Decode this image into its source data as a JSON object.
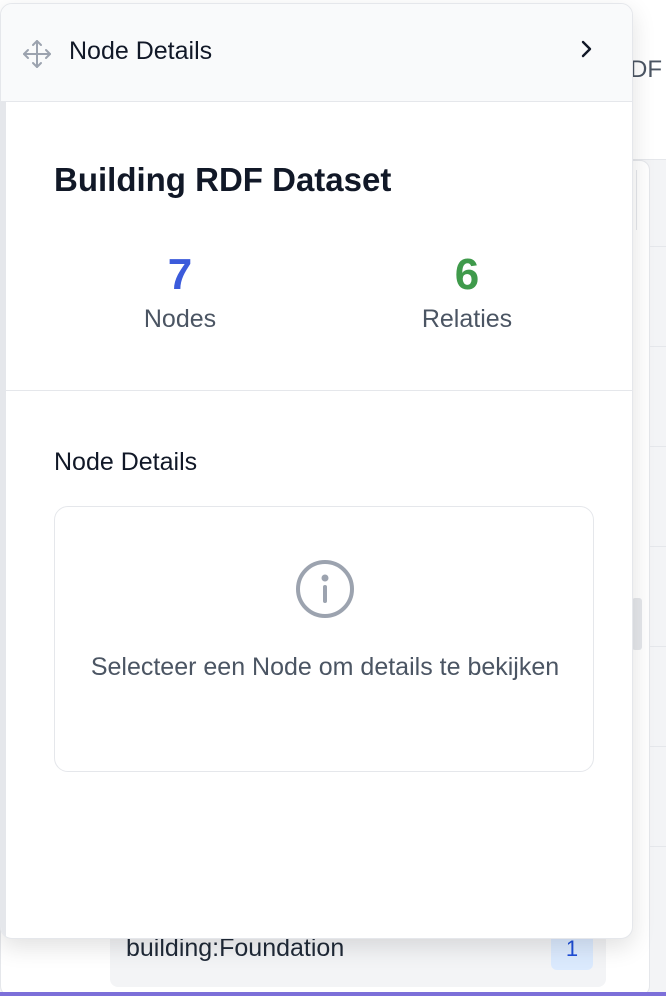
{
  "background": {
    "header_fragment": "DF",
    "foundation_label": "building:Foundation",
    "foundation_count": "1"
  },
  "panel": {
    "header_title": "Node Details",
    "dataset_title": "Building RDF Dataset",
    "stats": {
      "nodes_value": "7",
      "nodes_label": "Nodes",
      "relations_value": "6",
      "relations_label": "Relaties"
    },
    "section_title": "Node Details",
    "empty_message": "Selecteer een Node om details te bekijken"
  },
  "icons": {
    "move": "move-icon",
    "chevron": "chevron-right-icon",
    "info": "info-icon"
  },
  "colors": {
    "nodes_accent": "#3b5bdb",
    "relations_accent": "#3f9a4b",
    "badge_bg": "#dbeafe"
  }
}
